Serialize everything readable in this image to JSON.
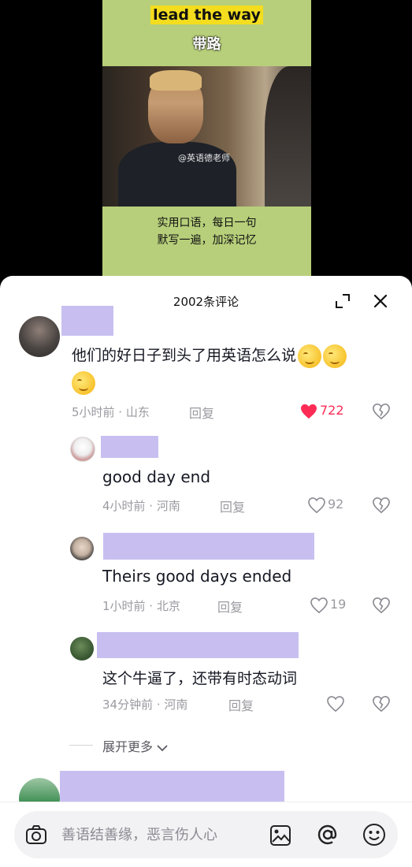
{
  "video": {
    "title_en": "lead the way",
    "title_zh": "带路",
    "watermark": "@英语德老师",
    "caption_line1": "实用口语，每日一句",
    "caption_line2": "默写一遍，加深记忆"
  },
  "comments_panel": {
    "title": "2002条评论"
  },
  "comments": [
    {
      "text": "他们的好日子到头了用英语怎么说",
      "meta": "5小时前 · 山东",
      "reply": "回复",
      "likes": "722",
      "liked": true
    },
    {
      "text": "good day end",
      "meta": "4小时前 · 河南",
      "reply": "回复",
      "likes": "92"
    },
    {
      "text": "Theirs good days ended",
      "meta": "1小时前 · 北京",
      "reply": "回复",
      "likes": "19"
    },
    {
      "text": "这个牛逼了，还带有时态动词",
      "meta": "34分钟前 · 河南",
      "reply": "回复",
      "likes": ""
    }
  ],
  "expand_more": "展开更多",
  "input": {
    "placeholder": "善语结善缘，恶言伤人心"
  },
  "colors": {
    "accent_like": "#fe2c55",
    "name_redaction": "#c8bff0"
  }
}
